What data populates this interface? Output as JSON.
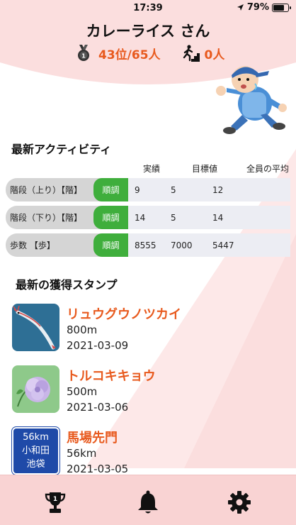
{
  "status_bar": {
    "time": "17:39",
    "battery": "79%",
    "battery_level": 0.79
  },
  "profile": {
    "username": "カレーライス さん",
    "rank": "43位/65人",
    "climber_count": "0人"
  },
  "activity": {
    "title": "最新アクティビティ",
    "columns": [
      "実績",
      "目標値",
      "全員の平均"
    ],
    "rows": [
      {
        "label": "階段（上り）【階】",
        "status": "順調",
        "actual": "9",
        "target": "5",
        "average": "12"
      },
      {
        "label": "階段（下り）【階】",
        "status": "順調",
        "actual": "14",
        "target": "5",
        "average": "14"
      },
      {
        "label": "歩数 【歩】",
        "status": "順調",
        "actual": "8555",
        "target": "7000",
        "average": "5447"
      }
    ]
  },
  "stamps": {
    "title": "最新の獲得スタンプ",
    "items": [
      {
        "name": "リュウグウノツカイ",
        "distance": "800m",
        "date": "2021-03-09"
      },
      {
        "name": "トルコキキョウ",
        "distance": "500m",
        "date": "2021-03-06"
      },
      {
        "name": "馬場先門",
        "distance": "56km",
        "date": "2021-03-05",
        "sign_top": "56km",
        "sign_mid": "小和田",
        "sign_bot": "池袋"
      }
    ]
  },
  "colors": {
    "accent": "#e85a1e",
    "ok_green": "#3fae3c",
    "nav_bg": "#f9d3d3",
    "bg_pink": "#fbdede"
  },
  "nav": {
    "items": [
      "trophy-icon",
      "bell-icon",
      "gear-icon"
    ]
  }
}
